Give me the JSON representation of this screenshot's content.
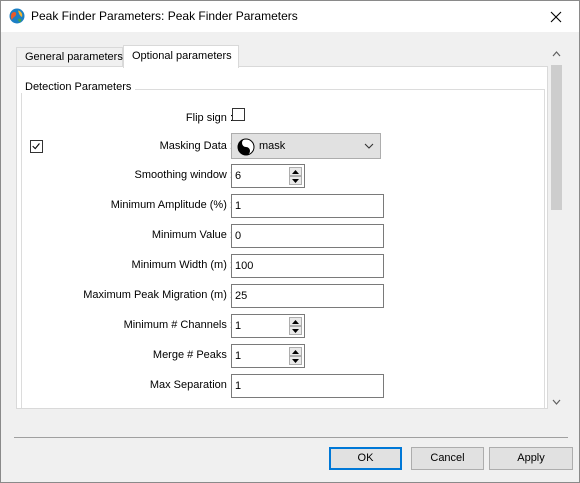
{
  "window": {
    "title": "Peak Finder Parameters: Peak Finder Parameters",
    "accent": "#0078d7"
  },
  "icons": {
    "app": "globe-app-icon",
    "close": "close-icon",
    "mask": "yin-yang-icon",
    "dropdown": "chevron-down-icon",
    "spin_up": "spin-up-icon",
    "spin_down": "spin-down-icon",
    "scroll_up": "scroll-up-icon",
    "scroll_down": "scroll-down-icon",
    "check": "check-icon"
  },
  "tabs": [
    {
      "label": "General parameters",
      "active": false
    },
    {
      "label": "Optional parameters",
      "active": true
    }
  ],
  "group": {
    "title": "Detection Parameters"
  },
  "fields": {
    "flip_sign": {
      "label": "Flip sign :",
      "checked": false
    },
    "masking_data": {
      "label": "Masking Data :",
      "enabled": true,
      "value": "mask"
    },
    "smoothing_window": {
      "label": "Smoothing window :",
      "value": "6"
    },
    "min_amplitude": {
      "label": "Minimum Amplitude (%) :",
      "value": "1"
    },
    "min_value": {
      "label": "Minimum Value :",
      "value": "0"
    },
    "min_width": {
      "label": "Minimum Width (m) :",
      "value": "100"
    },
    "max_peak_migration": {
      "label": "Maximum Peak Migration (m) :",
      "value": "25"
    },
    "min_channels": {
      "label": "Minimum # Channels :",
      "value": "1"
    },
    "merge_peaks": {
      "label": "Merge # Peaks :",
      "value": "1"
    },
    "max_separation": {
      "label": "Max Separation :",
      "value": "1"
    }
  },
  "buttons": {
    "ok": "OK",
    "cancel": "Cancel",
    "apply": "Apply"
  }
}
